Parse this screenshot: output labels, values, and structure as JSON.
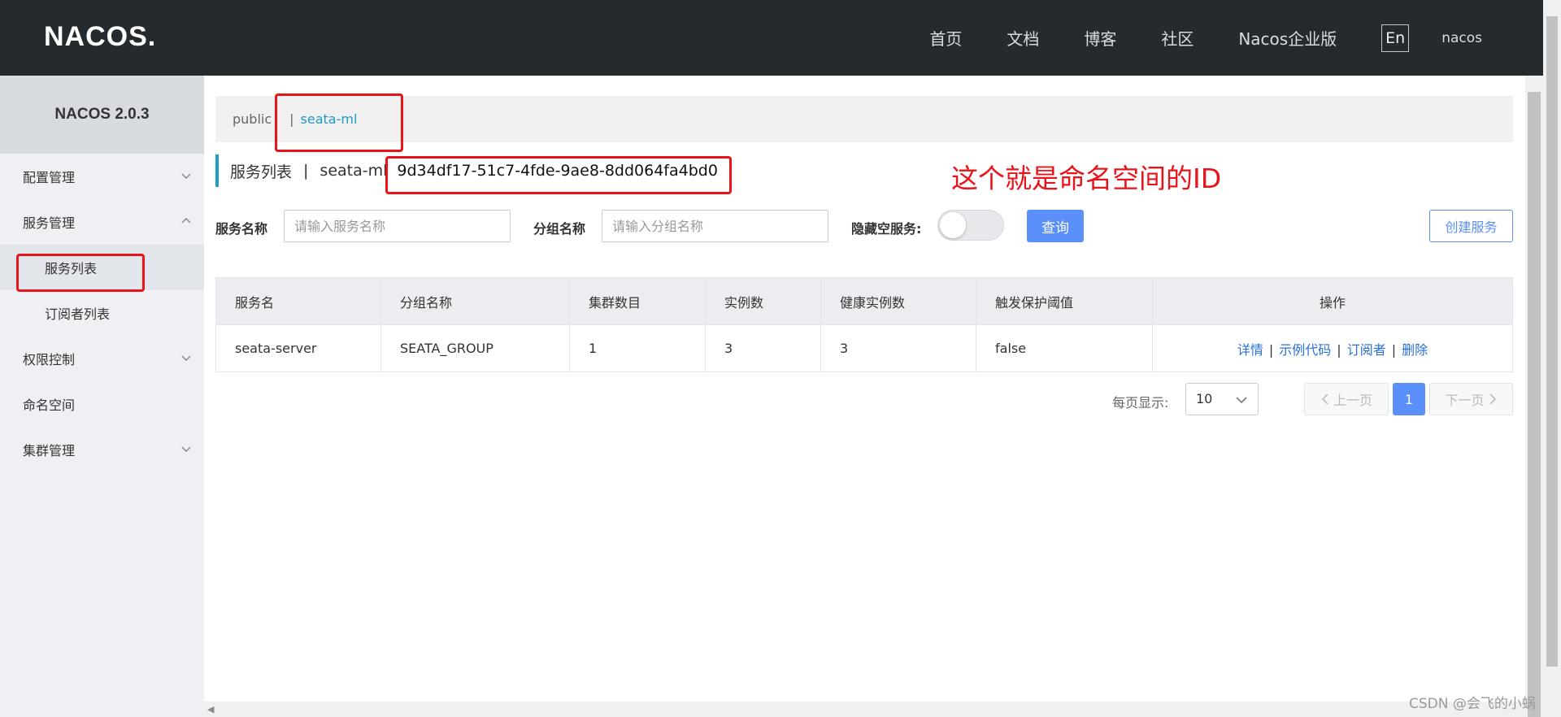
{
  "header": {
    "logo": "NACOS.",
    "nav": [
      "首页",
      "文档",
      "博客",
      "社区",
      "Nacos企业版"
    ],
    "lang": "En",
    "user": "nacos"
  },
  "sidebar": {
    "title": "NACOS 2.0.3",
    "items": [
      {
        "label": "配置管理",
        "chevron": "down"
      },
      {
        "label": "服务管理",
        "chevron": "up",
        "children": [
          {
            "label": "服务列表",
            "active": true
          },
          {
            "label": "订阅者列表",
            "active": false
          }
        ]
      },
      {
        "label": "权限控制",
        "chevron": "down"
      },
      {
        "label": "命名空间",
        "chevron": "none"
      },
      {
        "label": "集群管理",
        "chevron": "down"
      }
    ]
  },
  "namespace_bar": {
    "public": "public",
    "separator": "|",
    "active": "seata-ml"
  },
  "title": {
    "label": "服务列表",
    "pipe": "|",
    "namespace": "seata-ml",
    "namespace_id": "9d34df17-51c7-4fde-9ae8-8dd064fa4bd0"
  },
  "annotation": "这个就是命名空间的ID",
  "filters": {
    "service_name_label": "服务名称",
    "service_name_placeholder": "请输入服务名称",
    "group_name_label": "分组名称",
    "group_name_placeholder": "请输入分组名称",
    "hide_empty_label": "隐藏空服务:",
    "hide_empty_on": false,
    "query_button": "查询",
    "create_button": "创建服务"
  },
  "table": {
    "headers": [
      "服务名",
      "分组名称",
      "集群数目",
      "实例数",
      "健康实例数",
      "触发保护阈值",
      "操作"
    ],
    "rows": [
      [
        "seata-server",
        "SEATA_GROUP",
        "1",
        "3",
        "3",
        "false"
      ]
    ],
    "actions": [
      "详情",
      "示例代码",
      "订阅者",
      "删除"
    ]
  },
  "pagination": {
    "page_size_label": "每页显示:",
    "page_size": "10",
    "prev": "上一页",
    "current": "1",
    "next": "下一页"
  },
  "watermark": "CSDN @会飞的小蜗",
  "colors": {
    "header_bg": "#252a2f",
    "accent": "#209bc7",
    "primary": "#5b8ff9",
    "link": "#2a6fd6",
    "annotation_red": "#e8141a"
  }
}
